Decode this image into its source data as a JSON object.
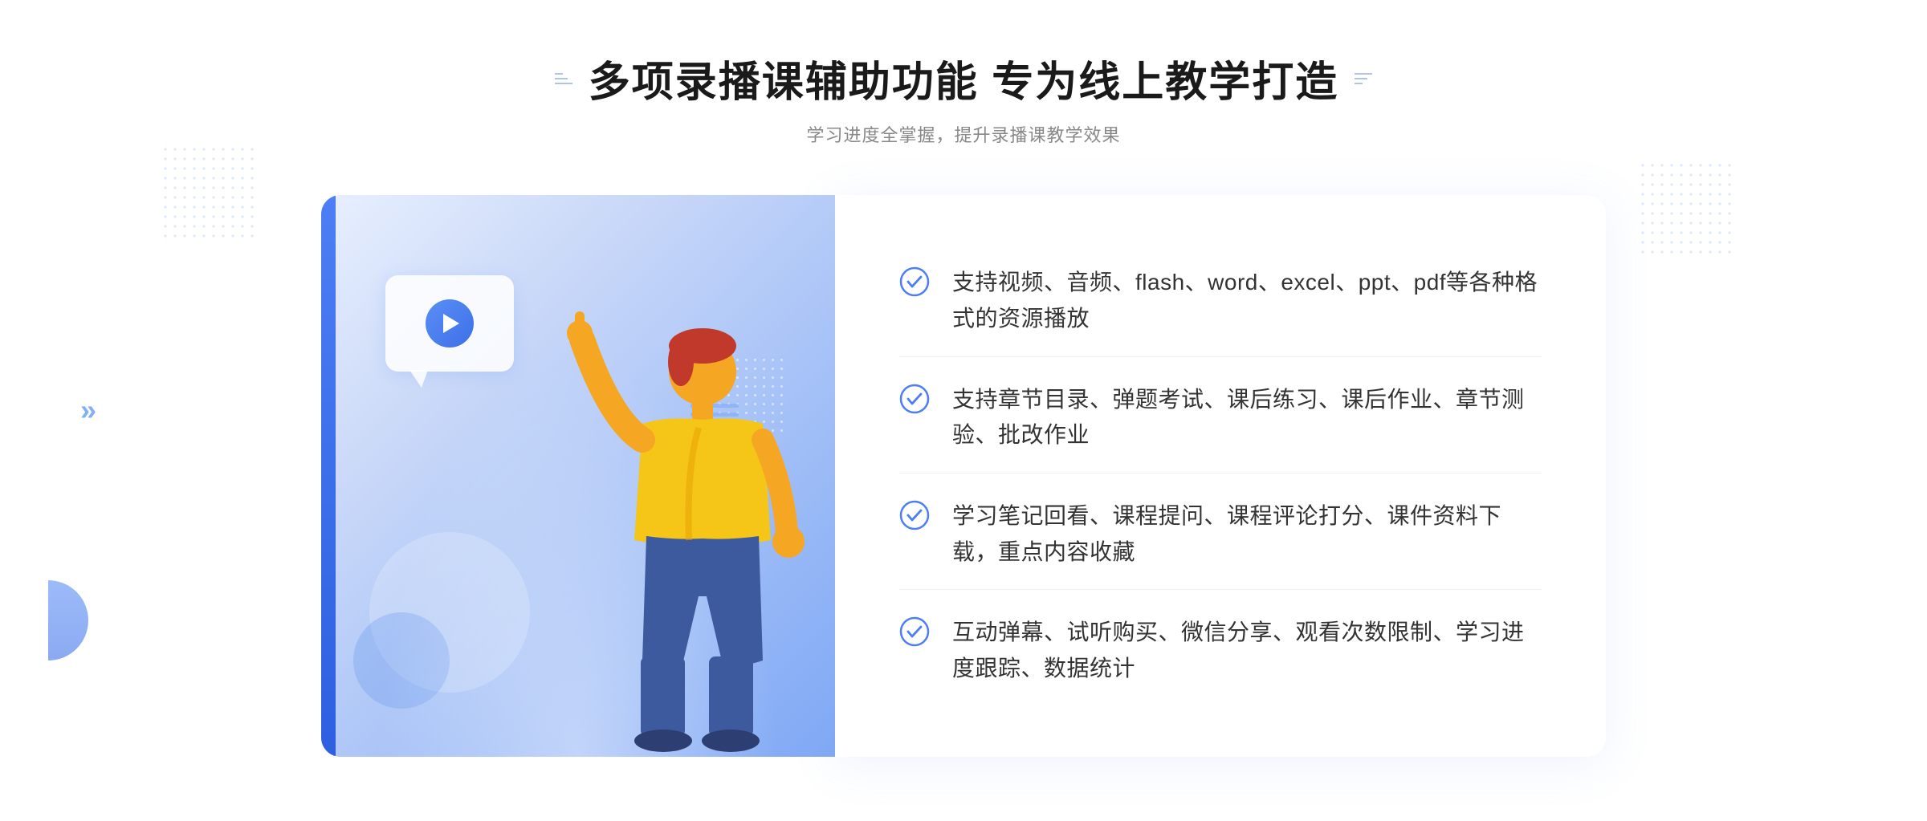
{
  "header": {
    "title": "多项录播课辅助功能 专为线上教学打造",
    "subtitle": "学习进度全掌握，提升录播课教学效果"
  },
  "features": [
    {
      "id": 1,
      "text": "支持视频、音频、flash、word、excel、ppt、pdf等各种格式的资源播放"
    },
    {
      "id": 2,
      "text": "支持章节目录、弹题考试、课后练习、课后作业、章节测验、批改作业"
    },
    {
      "id": 3,
      "text": "学习笔记回看、课程提问、课程评论打分、课件资料下载，重点内容收藏"
    },
    {
      "id": 4,
      "text": "互动弹幕、试听购买、微信分享、观看次数限制、学习进度跟踪、数据统计"
    }
  ],
  "colors": {
    "accent": "#4d7ef5",
    "check_color": "#4d7ef5",
    "title_color": "#1a1a1a",
    "subtitle_color": "#888888",
    "feature_text_color": "#333333"
  },
  "decorations": {
    "left_arrow": "»",
    "play_label": "play"
  }
}
